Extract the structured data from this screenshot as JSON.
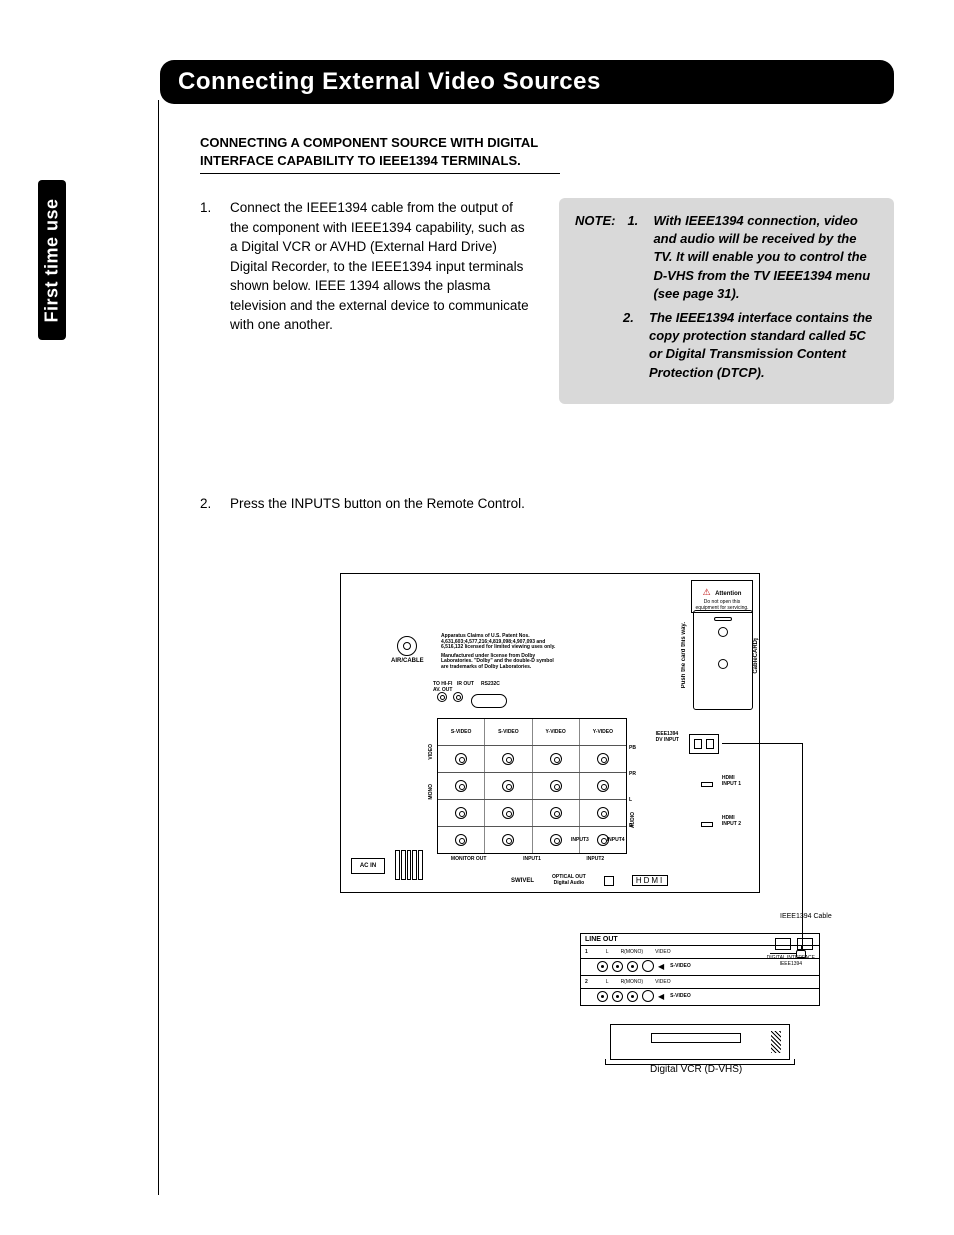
{
  "sideTab": "First time use",
  "title": "Connecting External  Video Sources",
  "subheading": "CONNECTING A COMPONENT SOURCE WITH DIGITAL INTERFACE CAPABILITY TO IEEE1394 TERMINALS.",
  "steps": {
    "s1num": "1.",
    "s1text": "Connect the IEEE1394 cable from the output of the component with IEEE1394 capability, such as a Digital VCR or AVHD (External Hard Drive) Digital Recorder, to the IEEE1394 input terminals shown below.  IEEE 1394 allows the plasma television and the external device to communicate with one another.",
    "s2num": "2.",
    "s2text": "Press the INPUTS button on the Remote Control."
  },
  "note": {
    "label": "NOTE:",
    "n1num": "1.",
    "n1text": "With IEEE1394 connection, video and audio will be received by the TV.  It will enable you to control the D-VHS from the TV IEEE1394 menu (see page 31).",
    "n2num": "2.",
    "n2text": "The IEEE1394 interface contains the copy protection standard called 5C or Digital Transmission Content Protection (DTCP)."
  },
  "diagram": {
    "attention": "Attention",
    "attentionSub": "Do not open this equipment for servicing.",
    "airCable": "AIR/CABLE",
    "patent": "Apparatus Claims of U.S. Patent Nos. 4,631,603;4,577,216;4,819,098;4,907,093 and 6,516,132 licensed for limited viewing uses only.",
    "dolby": "Manufactured under license from Dolby Laboratories. \"Dolby\" and the double-D symbol are trademarks of Dolby Laboratories.",
    "avOut": "TO HI-FI\nAV. OUT",
    "irOut": "IR OUT",
    "rs232c": "RS232C",
    "pushCard": "Push the card this way.",
    "cableCard": "CableCARD™",
    "yVideo": "Y-VIDEO",
    "sVideo": "S-VIDEO",
    "video": "VIDEO",
    "mono": "MONO",
    "pb": "PB",
    "pr": "PR",
    "audioL": "L",
    "audioR": "R",
    "audio": "AUDIO",
    "ieee1394": "IEEE1394\nDV INPUT",
    "hdmi1": "HDMI\nINPUT 1",
    "hdmi2": "HDMI\nINPUT 2",
    "monitorOut": "MONITOR OUT",
    "input1": "INPUT1",
    "input2": "INPUT2",
    "input3": "INPUT3",
    "input4": "INPUT4",
    "acIn": "AC IN",
    "swivel": "SWIVEL",
    "opticalOut": "OPTICAL OUT\nDigital Audio",
    "hdmiLogo": "HDMI",
    "cableLabel": "IEEE1394 Cable",
    "lineOut": "LINE OUT",
    "rowL": "L",
    "rowR": "R(MONO)",
    "rowVideo": "VIDEO",
    "rowSVideo": "S-VIDEO",
    "digitalInterface": "DIGITAL INTERFACE\nIEEE1394",
    "row1": "1",
    "row2": "2",
    "vcrCaption": "Digital VCR (D-VHS)"
  }
}
